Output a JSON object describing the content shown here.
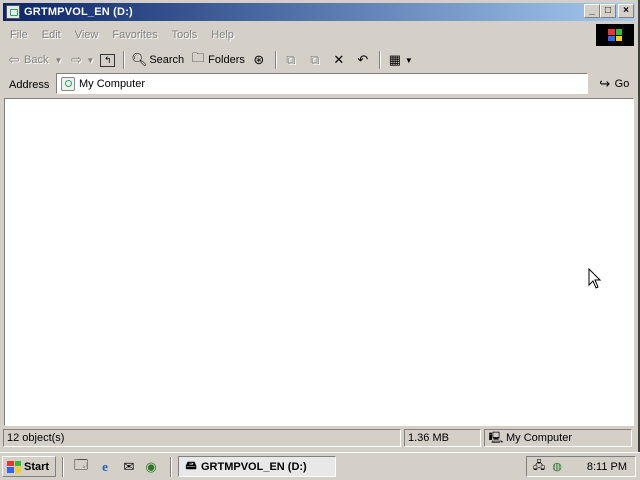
{
  "window": {
    "title": "GRTMPVOL_EN (D:)",
    "controls": {
      "minimize": "_",
      "maximize": "□",
      "close": "×"
    }
  },
  "menu": {
    "items": [
      "File",
      "Edit",
      "View",
      "Favorites",
      "Tools",
      "Help"
    ]
  },
  "toolbar": {
    "back_label": "Back",
    "search_label": "Search",
    "folders_label": "Folders"
  },
  "address": {
    "label": "Address",
    "value": "My Computer",
    "go_label": "Go"
  },
  "status": {
    "objects": "12 object(s)",
    "size": "1.36 MB",
    "location": "My Computer"
  },
  "taskbar": {
    "start_label": "Start",
    "task_title": "GRTMPVOL_EN (D:)",
    "clock": "8:11 PM"
  },
  "colors": {
    "title_start": "#0a246a",
    "title_end": "#a6caf0",
    "face": "#d4d0c8"
  }
}
